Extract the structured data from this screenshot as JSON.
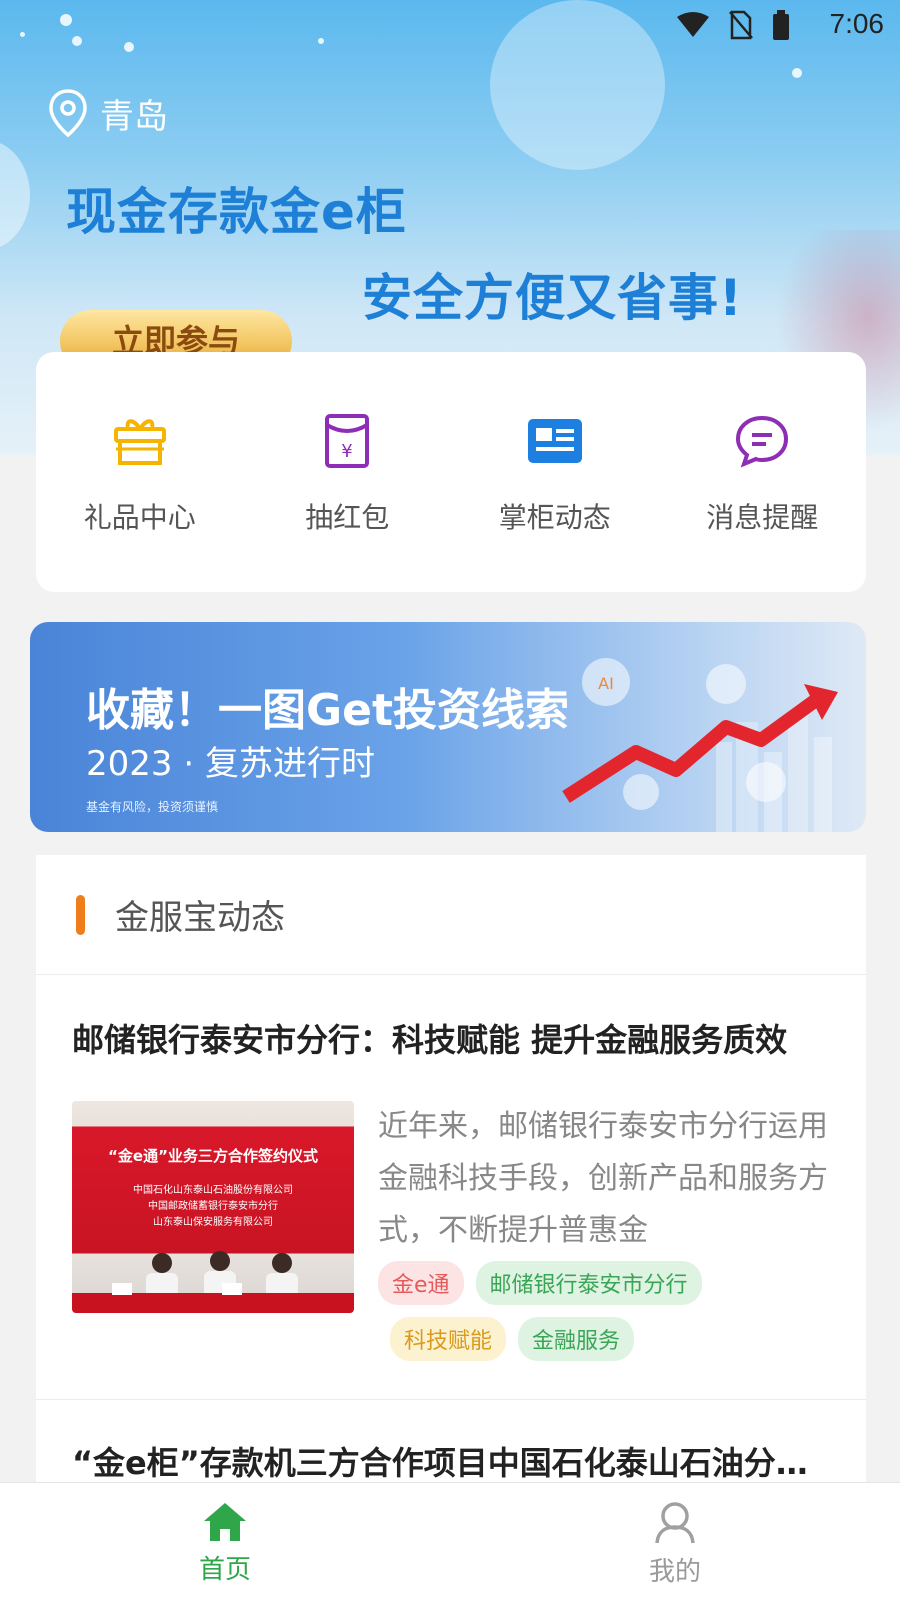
{
  "status_bar": {
    "time": "7:06"
  },
  "hero": {
    "location": "青岛",
    "title": "现金存款金e柜",
    "subtitle": "安全方便又省事!",
    "join_label": "立即参与"
  },
  "quick_menu": [
    {
      "label": "礼品中心",
      "icon": "gift-icon",
      "color": "#f5b400"
    },
    {
      "label": "抽红包",
      "icon": "red-envelope-icon",
      "color": "#8e2db5"
    },
    {
      "label": "掌柜动态",
      "icon": "news-icon",
      "color": "#1d80e0"
    },
    {
      "label": "消息提醒",
      "icon": "message-icon",
      "color": "#8e2db5"
    }
  ],
  "banner": {
    "title": "收藏！一图Get投资线索",
    "subtitle": "2023 · 复苏进行时",
    "note": "基金有风险，投资须谨慎"
  },
  "news": {
    "section_title": "金服宝动态",
    "articles": [
      {
        "title": "邮储银行泰安市分行：科技赋能 提升金融服务质效",
        "thumb": {
          "headline": "“金e通”业务三方合作签约仪式",
          "line1": "中国石化山东泰山石油股份有限公司",
          "line2": "中国邮政储蓄银行泰安市分行",
          "line3": "山东泰山保安服务有限公司"
        },
        "desc": "近年来，邮储银行泰安市分行运用金融科技手段，创新产品和服务方式，不断提升普惠金",
        "tags": [
          "金e通",
          "邮储银行泰安市分行",
          "科技赋能",
          "金融服务"
        ]
      },
      {
        "title": "“金e柜”存款机三方合作项目中国石化泰山石油分公司"
      }
    ]
  },
  "bottom_nav": {
    "home_label": "首页",
    "mine_label": "我的"
  }
}
